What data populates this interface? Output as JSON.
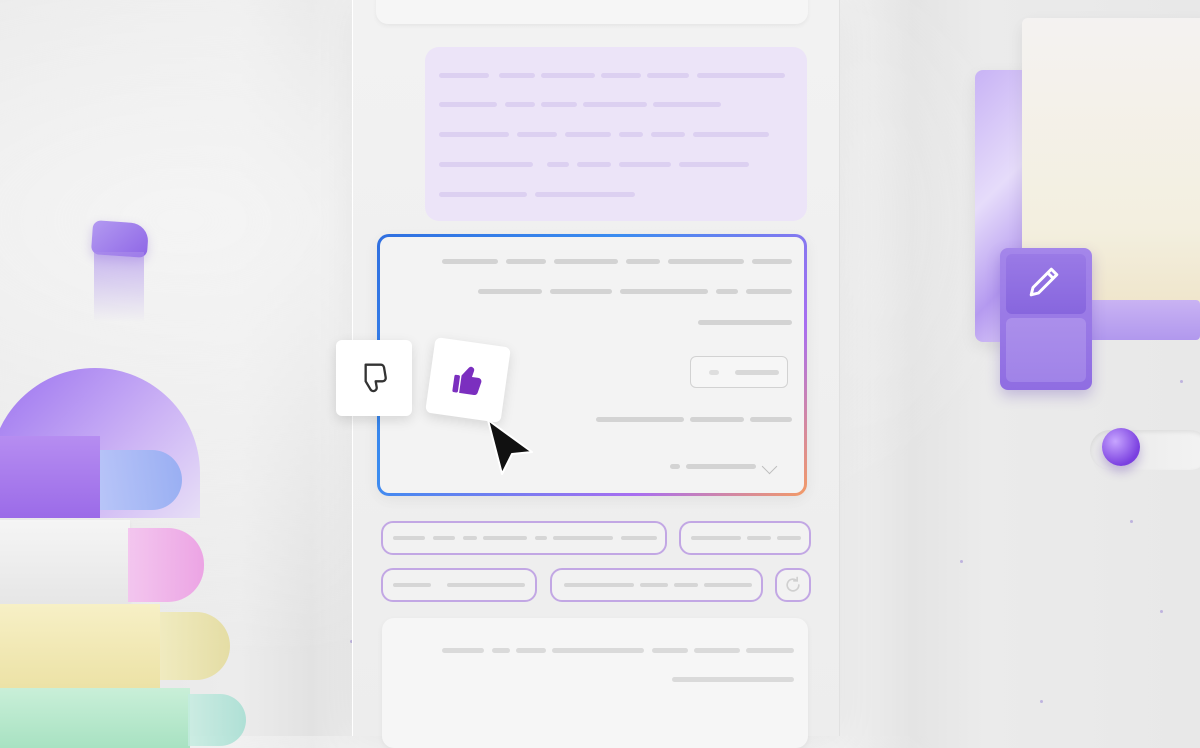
{
  "scene": {
    "description_free": true
  },
  "icons": {
    "thumbs_down": "thumbs-down-icon",
    "thumbs_up": "thumbs-up-icon",
    "cursor": "cursor-icon",
    "regenerate": "refresh-icon",
    "pencil": "pencil-icon",
    "chevron": "chevron-down-icon"
  },
  "colors": {
    "accent_purple": "#7b2fbf",
    "bubble_bg": "#ece4f8",
    "chip_border": "#c2a7e4",
    "gradient_start": "#2f6fe0",
    "gradient_end": "#f39b66"
  }
}
